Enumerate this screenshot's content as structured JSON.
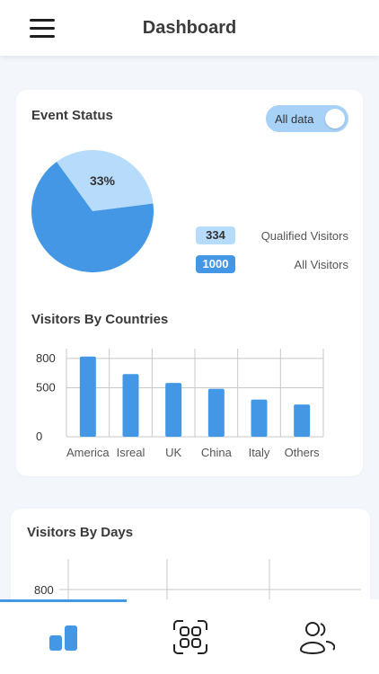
{
  "header": {
    "title": "Dashboard",
    "menu_icon": "hamburger-menu-icon"
  },
  "event_status": {
    "title": "Event Status",
    "toggle": {
      "label": "All data",
      "state": "on"
    },
    "pie": {
      "qualified_percent_label": "33%",
      "qualified_fraction": 0.33
    },
    "legend": [
      {
        "value": "334",
        "label": "Qualified Visitors",
        "color": "#b7dbfa"
      },
      {
        "value": "1000",
        "label": "All Visitors",
        "color": "#4397e4"
      }
    ]
  },
  "countries": {
    "title": "Visitors By Countries"
  },
  "days": {
    "title": "Visitors By Days"
  },
  "colors": {
    "accent": "#4397e4",
    "accent_light": "#b7dbfa",
    "background": "#f3f7fb"
  },
  "bottom_nav": [
    {
      "icon": "bar-chart-icon",
      "active": true
    },
    {
      "icon": "scan-icon",
      "active": false
    },
    {
      "icon": "users-icon",
      "active": false
    }
  ],
  "chart_data": [
    {
      "type": "pie",
      "slices": [
        {
          "label": "33%",
          "value": 33,
          "color": "#b7dbfa"
        },
        {
          "label": "",
          "value": 67,
          "color": "#4397e4"
        }
      ]
    },
    {
      "type": "bar",
      "title": "Visitors By Countries",
      "categories": [
        "America",
        "Isreal",
        "UK",
        "China",
        "Italy",
        "Others"
      ],
      "values": [
        820,
        640,
        550,
        490,
        380,
        330
      ],
      "yticks": [
        "800",
        "500",
        "0"
      ],
      "ytick_values": [
        800,
        500,
        0
      ],
      "ylim": [
        0,
        900
      ],
      "grid": true,
      "color": "#4397e4"
    },
    {
      "type": "line",
      "title": "Visitors By Days",
      "yticks": [
        "800"
      ],
      "ytick_values": [
        800
      ],
      "grid": true
    }
  ]
}
